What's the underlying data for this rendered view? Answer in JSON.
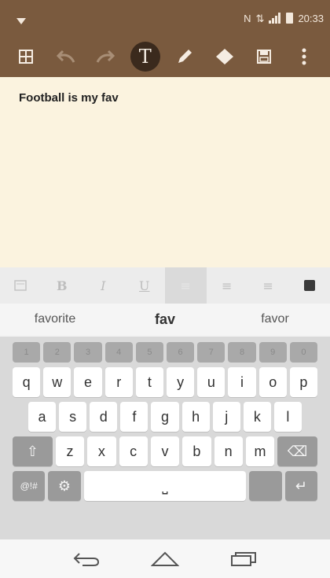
{
  "status": {
    "time": "20:33",
    "icons": [
      "notification-icon",
      "nfc-icon",
      "signal-icon",
      "wifi-signal-icon",
      "battery-icon"
    ]
  },
  "toolbar": {
    "items": [
      {
        "name": "grid-icon",
        "glyph": "▦"
      },
      {
        "name": "undo-icon",
        "glyph": "↶"
      },
      {
        "name": "redo-icon",
        "glyph": "↷"
      },
      {
        "name": "text-tool-icon",
        "glyph": "T"
      },
      {
        "name": "pen-icon",
        "glyph": "✎"
      },
      {
        "name": "eraser-icon",
        "glyph": "◆"
      },
      {
        "name": "save-icon",
        "glyph": "▣"
      },
      {
        "name": "more-options-icon",
        "glyph": "⋮"
      }
    ]
  },
  "editor": {
    "text": "Football is my fav"
  },
  "format": {
    "items": [
      {
        "name": "keyboard-toggle-icon",
        "glyph": "⌨"
      },
      {
        "name": "bold-button",
        "glyph": "B"
      },
      {
        "name": "italic-button",
        "glyph": "I"
      },
      {
        "name": "underline-button",
        "glyph": "U"
      },
      {
        "name": "align-left-button",
        "glyph": "≡"
      },
      {
        "name": "align-center-button",
        "glyph": "≡"
      },
      {
        "name": "align-right-button",
        "glyph": "≡"
      },
      {
        "name": "text-color-button",
        "glyph": ""
      }
    ]
  },
  "suggestions": {
    "left": "favorite",
    "center": "fav",
    "right": "favor"
  },
  "keyboard": {
    "numbers": [
      "1",
      "2",
      "3",
      "4",
      "5",
      "6",
      "7",
      "8",
      "9",
      "0"
    ],
    "row1": [
      "q",
      "w",
      "e",
      "r",
      "t",
      "y",
      "u",
      "i",
      "o",
      "p"
    ],
    "row2": [
      "a",
      "s",
      "d",
      "f",
      "g",
      "h",
      "j",
      "k",
      "l"
    ],
    "row3": [
      "z",
      "x",
      "c",
      "v",
      "b",
      "n",
      "m"
    ],
    "symbols_label": "@!#",
    "shift_glyph": "⇧",
    "backspace_glyph": "⌫",
    "settings_glyph": "⚙",
    "enter_glyph": "↵",
    "space_glyph": "⎵"
  },
  "nav": {
    "back": "back-icon",
    "home": "home-icon",
    "recents": "recents-icon"
  },
  "colors": {
    "toolbar": "#7a5a3e",
    "editor_bg": "#fbf3df",
    "keyboard_bg": "#d9d9d9"
  }
}
